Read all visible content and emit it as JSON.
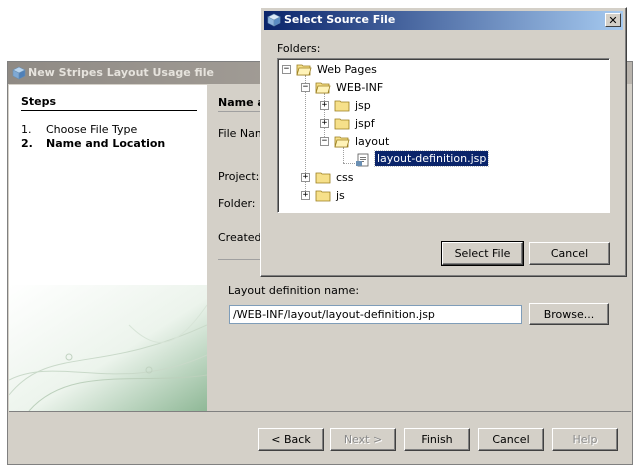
{
  "wizard": {
    "title": "New Stripes Layout Usage file",
    "steps_heading": "Steps",
    "steps": [
      {
        "number": "1.",
        "label": "Choose File Type",
        "current": false
      },
      {
        "number": "2.",
        "label": "Name and Location",
        "current": true
      }
    ],
    "panel_heading": "Name a",
    "labels": {
      "file_name": "File Nam",
      "project": "Project:",
      "folder": "Folder:",
      "created": "Created"
    },
    "layout_definition_label": "Layout definition name:",
    "layout_definition_value": "/WEB-INF/layout/layout-definition.jsp",
    "browse_label": "Browse...",
    "buttons": {
      "back": "< Back",
      "next": "Next >",
      "finish": "Finish",
      "cancel": "Cancel",
      "help": "Help"
    }
  },
  "dialog": {
    "title": "Select Source File",
    "close_glyph": "✕",
    "folders_label": "Folders:",
    "tree": {
      "web_pages": "Web Pages",
      "web_inf": "WEB-INF",
      "jsp": "jsp",
      "jspf": "jspf",
      "layout": "layout",
      "layout_definition": "layout-definition.jsp",
      "css": "css",
      "js": "js"
    },
    "select_file_label": "Select File",
    "cancel_label": "Cancel"
  },
  "colors": {
    "dialog_title_start": "#0a246a",
    "dialog_title_end": "#a6caf0",
    "selection": "#0a246a",
    "window_face": "#d4d0c8"
  },
  "icons": {
    "app": "netbeans-cube-icon",
    "folder_closed": "folder-icon",
    "folder_open": "open-folder-icon",
    "jsp_file": "jsp-file-icon",
    "close": "close-icon"
  }
}
